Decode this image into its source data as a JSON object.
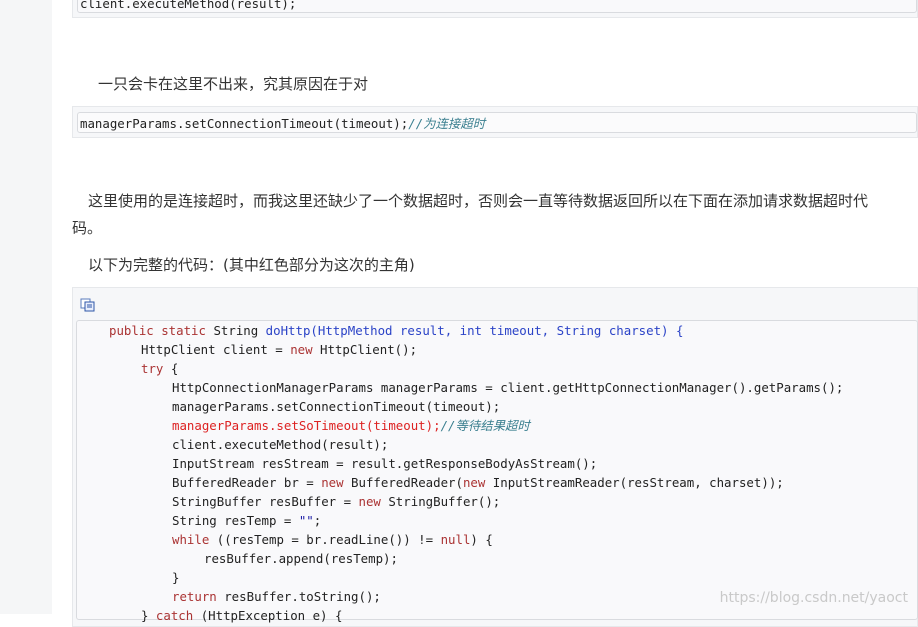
{
  "top_code": {
    "line": "client.executeMethod(result);"
  },
  "para1": "一只会卡在这里不出来，究其原因在于对",
  "code2": {
    "code": "managerParams.setConnectionTimeout(timeout);",
    "comment": "//为连接超时"
  },
  "para2_line1": "这里使用的是连接超时，而我这里还缺少了一个数据超时，否则会一直等待数据返回所以在下面在添加请求数据超时代",
  "para2_line2": "码。",
  "para3": "以下为完整的代码：(其中红色部分为这次的主角)",
  "code3": {
    "l1_kw": "public static",
    "l1_type": " String ",
    "l1_rest": "doHttp(HttpMethod result, int timeout, String charset) {",
    "l2_a": "HttpClient client = ",
    "l2_new": "new",
    "l2_b": " HttpClient();",
    "l3": "try",
    "l3_b": " {",
    "l4": "HttpConnectionManagerParams managerParams = client.getHttpConnectionManager().getParams();",
    "l5": "managerParams.setConnectionTimeout(timeout);",
    "l6_red": "managerParams.setSoTimeout(timeout);",
    "l6_cmt": "//等待结果超时",
    "l7": "client.executeMethod(result);",
    "l8": "InputStream resStream = result.getResponseBodyAsStream();",
    "l9_a": "BufferedReader br = ",
    "l9_new": "new",
    "l9_b": " BufferedReader(",
    "l9_new2": "new",
    "l9_c": " InputStreamReader(resStream, charset));",
    "l10_a": "StringBuffer resBuffer = ",
    "l10_new": "new",
    "l10_b": " StringBuffer();",
    "l11_a": "String resTemp = ",
    "l11_str": "\"\"",
    "l11_b": ";",
    "l12_while": "while",
    "l12_a": " ((resTemp = br.readLine()) != ",
    "l12_null": "null",
    "l12_b": ") {",
    "l13": "resBuffer.append(resTemp);",
    "l14": "}",
    "l15_ret": "return",
    "l15_b": " resBuffer.toString();",
    "l16_a": "} ",
    "l16_catch": "catch",
    "l16_b": " (HttpException e) {"
  },
  "watermark": "https://blog.csdn.net/yaoct",
  "icons": {
    "copy": "copy-icon"
  },
  "colors": {
    "keyword": "#a33",
    "highlight": "#d22",
    "comment": "#3a7f8f"
  }
}
